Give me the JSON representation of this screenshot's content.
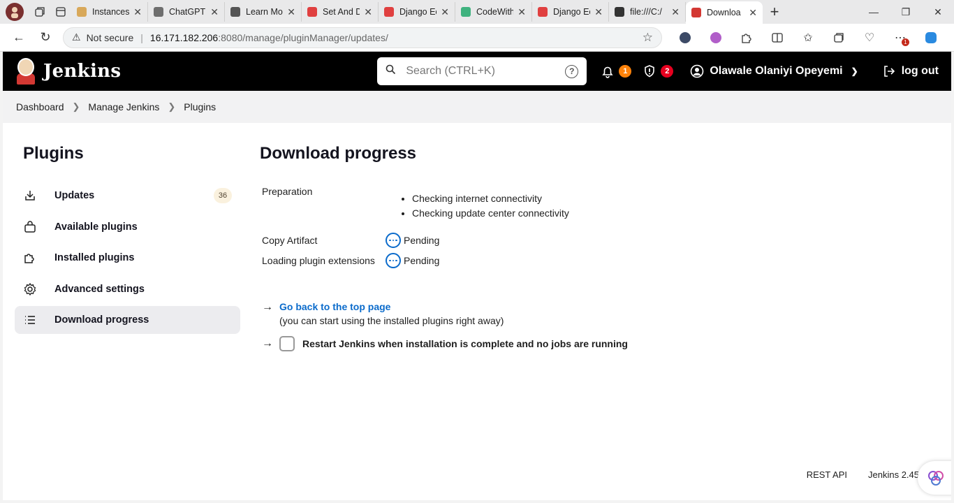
{
  "browser": {
    "tabs": [
      {
        "title": "Instances",
        "favicon_color": "#d8a85a"
      },
      {
        "title": "ChatGPT",
        "favicon_color": "#6e6e6e"
      },
      {
        "title": "Learn Mo",
        "favicon_color": "#555555"
      },
      {
        "title": "Set And D",
        "favicon_color": "#e04040"
      },
      {
        "title": "Django Ec",
        "favicon_color": "#e04040"
      },
      {
        "title": "CodeWith",
        "favicon_color": "#3fb27f"
      },
      {
        "title": "Django Ec",
        "favicon_color": "#e04040"
      },
      {
        "title": "file:///C:/",
        "favicon_color": "#333333"
      },
      {
        "title": "Downloa",
        "favicon_color": "#d33833",
        "active": true
      }
    ],
    "address": {
      "security_label": "Not secure",
      "host": "16.171.182.206",
      "port_path": ":8080/manage/pluginManager/updates/"
    },
    "notification_badge": "1"
  },
  "header": {
    "brand": "Jenkins",
    "search_placeholder": "Search (CTRL+K)",
    "notifications_count": "1",
    "security_count": "2",
    "user_name": "Olawale Olaniyi Opeyemi",
    "logout_label": "log out"
  },
  "breadcrumb": [
    "Dashboard",
    "Manage Jenkins",
    "Plugins"
  ],
  "sidebar": {
    "title": "Plugins",
    "items": [
      {
        "label": "Updates",
        "icon": "download-icon",
        "count": "36"
      },
      {
        "label": "Available plugins",
        "icon": "shopping-bag-icon"
      },
      {
        "label": "Installed plugins",
        "icon": "puzzle-icon"
      },
      {
        "label": "Advanced settings",
        "icon": "gear-icon"
      },
      {
        "label": "Download progress",
        "icon": "list-icon",
        "active": true
      }
    ]
  },
  "main": {
    "title": "Download progress",
    "preparation_label": "Preparation",
    "preparation_steps": [
      "Checking internet connectivity",
      "Checking update center connectivity"
    ],
    "jobs": [
      {
        "name": "Copy Artifact",
        "status": "Pending"
      },
      {
        "name": "Loading plugin extensions",
        "status": "Pending"
      }
    ],
    "back_link": "Go back to the top page",
    "back_note": "(you can start using the installed plugins right away)",
    "restart_label": "Restart Jenkins when installation is complete and no jobs are running"
  },
  "footer": {
    "rest_api": "REST API",
    "version": "Jenkins 2.45"
  },
  "colors": {
    "accent": "#0b6bcb",
    "header_bg": "#000000",
    "orange_badge": "#fe820a",
    "red_badge": "#e6001f"
  }
}
